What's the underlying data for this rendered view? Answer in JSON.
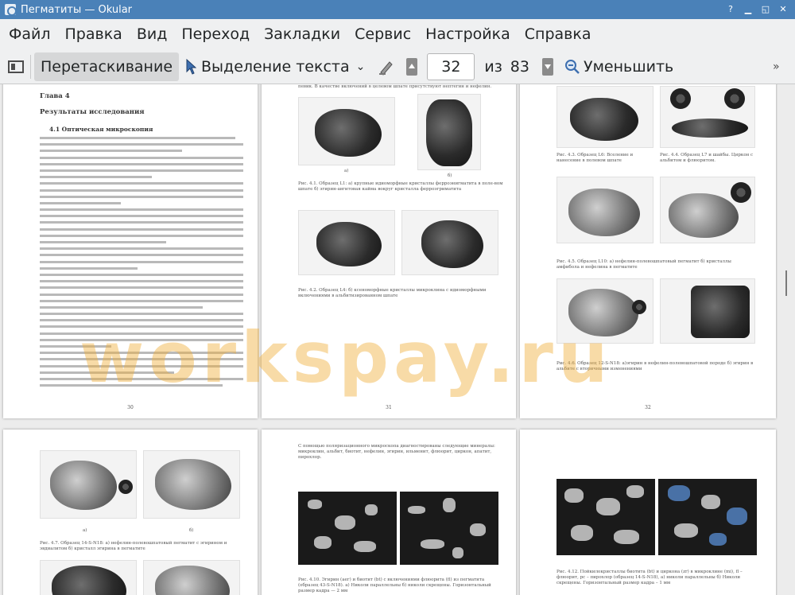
{
  "window": {
    "title": "Пегматиты  — Okular"
  },
  "menu": [
    "Файл",
    "Правка",
    "Вид",
    "Переход",
    "Закладки",
    "Сервис",
    "Настройка",
    "Справка"
  ],
  "toolbar": {
    "drag_label": "Перетаскивание",
    "select_label": "Выделение текста",
    "page_current": "32",
    "page_of": "из",
    "page_total": "83",
    "zoom_out_label": "Уменьшить"
  },
  "pages": {
    "p30": {
      "chapter": "Глава 4",
      "title": "Результаты исследования",
      "section": "4.1   Оптическая микроскопия",
      "number": "30"
    },
    "p31": {
      "top_text": "певик. В качестве включений в целевом шпате присутствуют нептегин и нефелин.",
      "label_a": "а)",
      "label_b": "б)",
      "caption1": "Рис. 4.1. Образец L1: а) крупные идиоморфные кристаллы ферроэнигматита в поле-вом шпате б) эгирин-авгитовая кайма вокруг кристалла ферроэгриматита",
      "caption2": "Рис. 4.2. Образец L4: б) ксеноморфные кристаллы микроклина с идиоморфными включениями в альбитизированном шпате",
      "number": "31"
    },
    "p32": {
      "caption1": "Рис. 4.3. Образец L6: Вселение и нанесение в полевом шпате",
      "caption2": "Рис. 4.4. Образец L7 и шайбы. Циркон с альбитом и флюоритом.",
      "caption3": "Рис. 4.5. Образец L10: а) нефелин-полевошпатовый пегматит б) кристаллы амфибола и нефелина в пегматите",
      "caption4": "Рис. 4.6. Образец 12-S-N18: а)эгирин в нефелин-полевошпатовой породе б) эгирин в альбите с вторичными изменениями",
      "number": "32"
    },
    "p33": {
      "label_a": "а)",
      "label_b": "б)",
      "caption": "Рис. 4.7. Образец 14-S-N18: а) нефелин-полевошпатовый пегматит с эгирином и эвдиалитом б) кристалл эгирина в пегматите"
    },
    "p34": {
      "top_text": "С помощью поляризационного микроскопа диагностированы следующие минералы: микроклин, альбит, биотит, нефелин, эгирин, ильменит, флюорит, циркон, апатит, пирохлор.",
      "caption": "Рис. 4.10. Эгирин (аег) и биотит (bt) с включениями флюорита (fl) из пегматита (образец 43-S-N18). а) Николи параллельны б) николи скрещены. Горизонтальный размер кадра — 2 мм"
    },
    "p35": {
      "caption": "Рис. 4.12. Пойкилокристаллы биотита (bt) и циркона (zr) в микроклине (mi), fl – флюорит, pc – пирохлор (образец 14-S-N18), а) николи параллельны б) Николи скрещены. Горизонтальный размер кадра – 1 мм"
    }
  },
  "watermark": "workspay.ru",
  "colors": {
    "titlebar": "#4a81b8",
    "chrome": "#eff0f1",
    "watermark": "#f0b03c"
  }
}
